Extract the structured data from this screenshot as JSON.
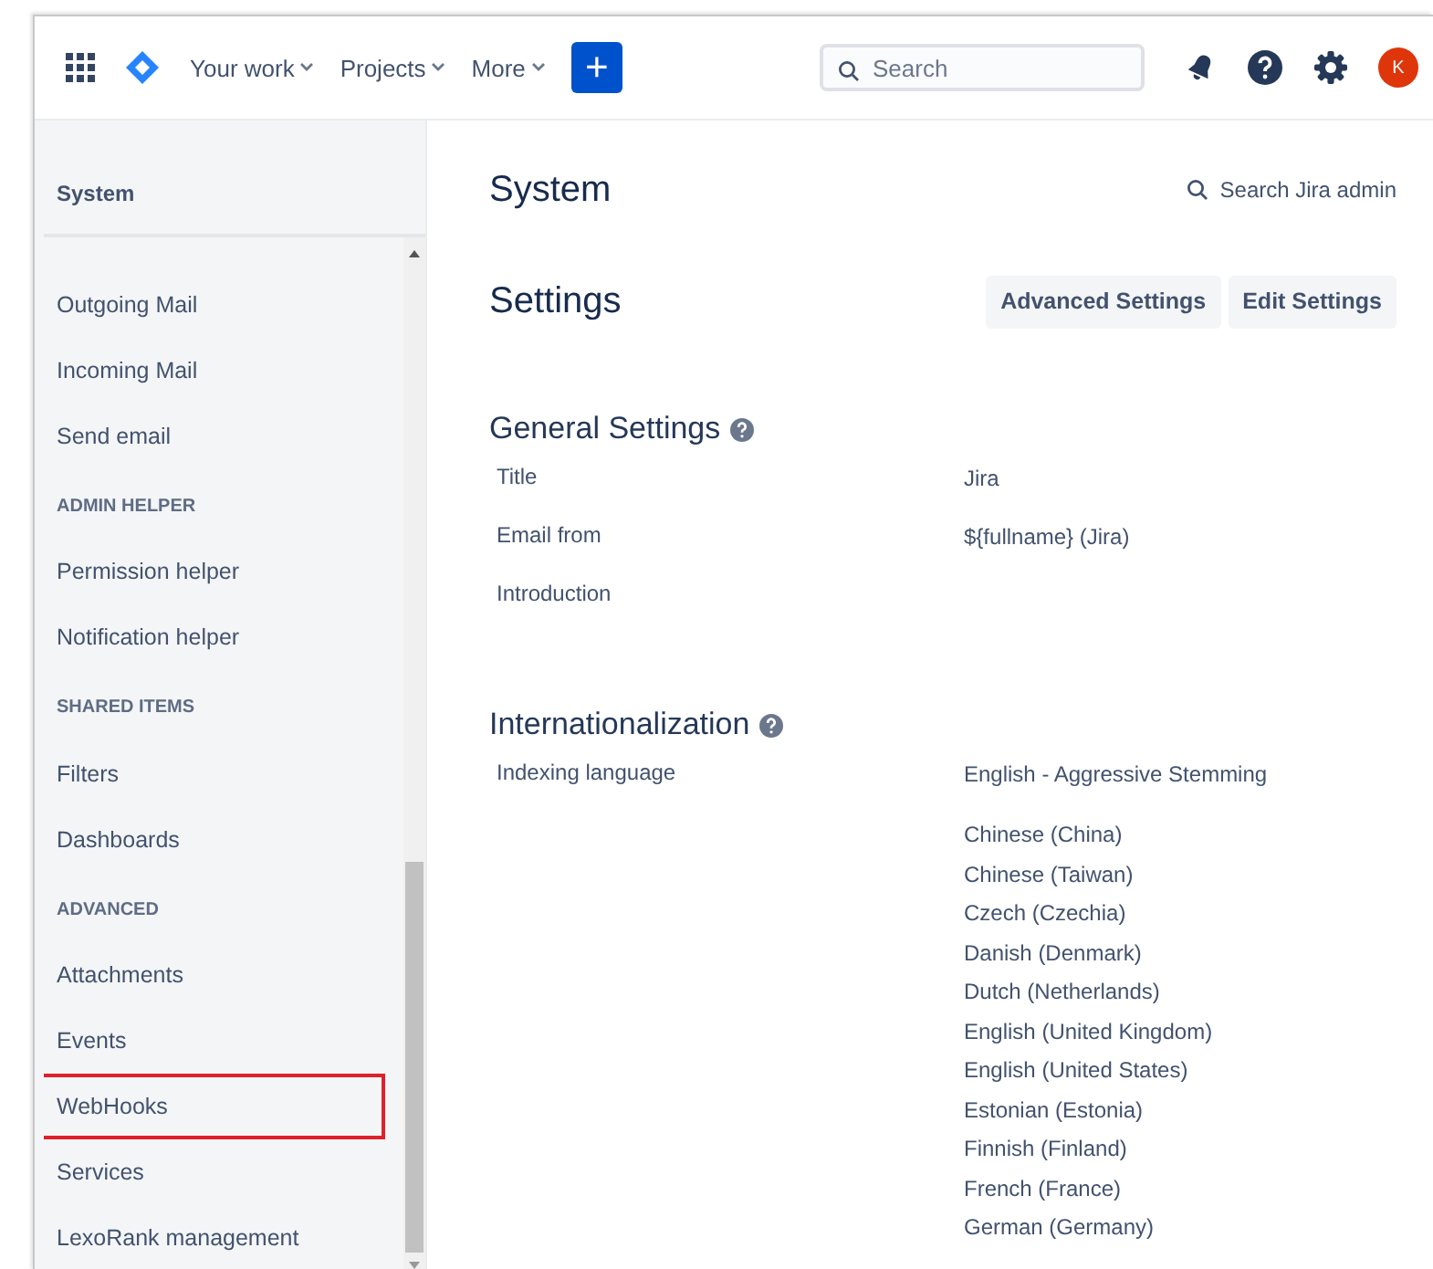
{
  "topbar": {
    "nav": [
      {
        "label": "Your work",
        "dropdown": true
      },
      {
        "label": "Projects",
        "dropdown": true
      },
      {
        "label": "More",
        "dropdown": true
      }
    ],
    "create": "+",
    "search": {
      "placeholder": "Search"
    },
    "avatar": "K"
  },
  "sidebar": {
    "title": "System",
    "items": [
      {
        "kind": "item",
        "label": "Outgoing Mail",
        "highlighted": false
      },
      {
        "kind": "item",
        "label": "Incoming Mail",
        "highlighted": false
      },
      {
        "kind": "item",
        "label": "Send email",
        "highlighted": false
      },
      {
        "kind": "heading",
        "label": "ADMIN HELPER"
      },
      {
        "kind": "item",
        "label": "Permission helper",
        "highlighted": false
      },
      {
        "kind": "item",
        "label": "Notification helper",
        "highlighted": false
      },
      {
        "kind": "heading",
        "label": "SHARED ITEMS"
      },
      {
        "kind": "item",
        "label": "Filters",
        "highlighted": false
      },
      {
        "kind": "item",
        "label": "Dashboards",
        "highlighted": false
      },
      {
        "kind": "heading",
        "label": "ADVANCED"
      },
      {
        "kind": "item",
        "label": "Attachments",
        "highlighted": false
      },
      {
        "kind": "item",
        "label": "Events",
        "highlighted": false
      },
      {
        "kind": "item",
        "label": "WebHooks",
        "highlighted": true
      },
      {
        "kind": "item",
        "label": "Services",
        "highlighted": false
      },
      {
        "kind": "item",
        "label": "LexoRank management",
        "highlighted": false
      }
    ]
  },
  "main": {
    "title": "System",
    "admin_search": "Search Jira admin",
    "page_title": "Settings",
    "buttons": [
      "Advanced Settings",
      "Edit Settings"
    ],
    "sections": [
      {
        "title": "General Settings",
        "rows": [
          {
            "label": "Title",
            "values": [
              "Jira"
            ]
          },
          {
            "label": "Email from",
            "values": [
              "${fullname} (Jira)"
            ]
          },
          {
            "label": "Introduction",
            "values": []
          }
        ]
      },
      {
        "title": "Internationalization",
        "rows": [
          {
            "label": "Indexing language",
            "values": [
              "English - Aggressive Stemming"
            ]
          },
          {
            "label": "",
            "values": [
              "Chinese (China)",
              "Chinese (Taiwan)",
              "Czech (Czechia)",
              "Danish (Denmark)",
              "Dutch (Netherlands)",
              "English (United Kingdom)",
              "English (United States)",
              "Estonian (Estonia)",
              "Finnish (Finland)",
              "French (France)",
              "German (Germany)"
            ]
          }
        ]
      }
    ]
  }
}
